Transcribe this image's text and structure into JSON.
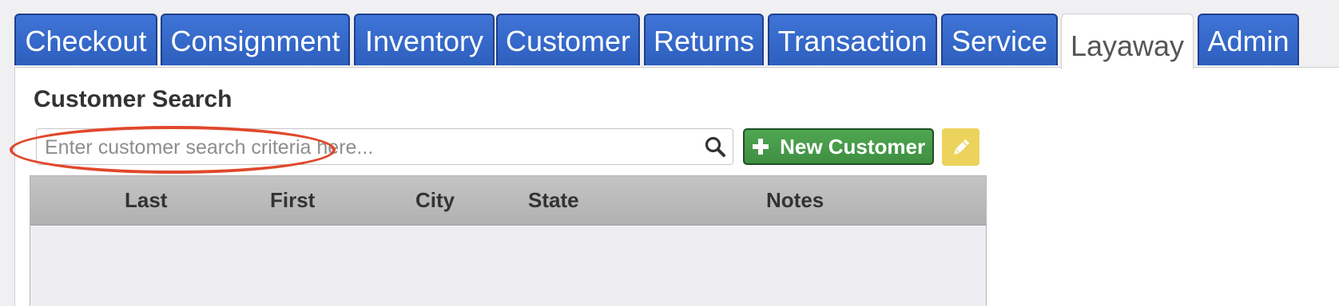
{
  "tabs": [
    {
      "label": "Checkout"
    },
    {
      "label": "Consignment"
    },
    {
      "label": "Inventory"
    },
    {
      "label": "Customer"
    },
    {
      "label": "Returns"
    },
    {
      "label": "Transaction"
    },
    {
      "label": "Service"
    },
    {
      "label": "Layaway",
      "active": true
    },
    {
      "label": "Admin"
    }
  ],
  "customer_search": {
    "title": "Customer Search",
    "placeholder": "Enter customer search criteria here...",
    "value": "",
    "search_icon": "search-icon"
  },
  "actions": {
    "new_customer_label": "New Customer",
    "new_customer_icon": "plus-icon",
    "edit_icon": "pencil-icon"
  },
  "grid": {
    "columns": [
      "Last",
      "First",
      "City",
      "State",
      "Notes"
    ],
    "rows": []
  },
  "colors": {
    "tab_blue": "#2d5fbe",
    "new_customer_green": "#3f8f42",
    "edit_yellow": "#ecd35c",
    "annotation_red": "#e0482c"
  }
}
